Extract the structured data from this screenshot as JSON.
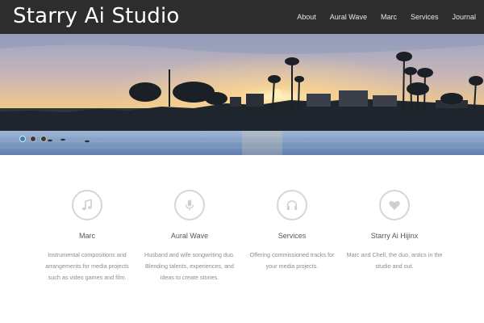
{
  "site": {
    "title": "Starry Ai Studio"
  },
  "nav": {
    "items": [
      {
        "label": "About"
      },
      {
        "label": "Aural Wave"
      },
      {
        "label": "Marc"
      },
      {
        "label": "Services"
      },
      {
        "label": "Journal"
      }
    ]
  },
  "slider": {
    "slide_count": 3,
    "active_index": 0
  },
  "features": [
    {
      "icon": "music-note-icon",
      "title": "Marc",
      "description": "Instrumental compositions and arrangements for media projects such as video games and film."
    },
    {
      "icon": "microphone-icon",
      "title": "Aural Wave",
      "description": "Husband and wife songwriting duo. Blending talents, experiences, and ideas to create stories."
    },
    {
      "icon": "headphones-icon",
      "title": "Services",
      "description": "Offering commissioned tracks for your media projects."
    },
    {
      "icon": "heart-icon",
      "title": "Starry Ai Hijinx",
      "description": "Marc and Chell, the duo, antics in the studio and out."
    }
  ],
  "colors": {
    "header_bg": "#2d2d2d",
    "icon_border": "#d6d6d6",
    "text_muted": "#8c8c8c",
    "slider_active": "#3e7fb3"
  }
}
